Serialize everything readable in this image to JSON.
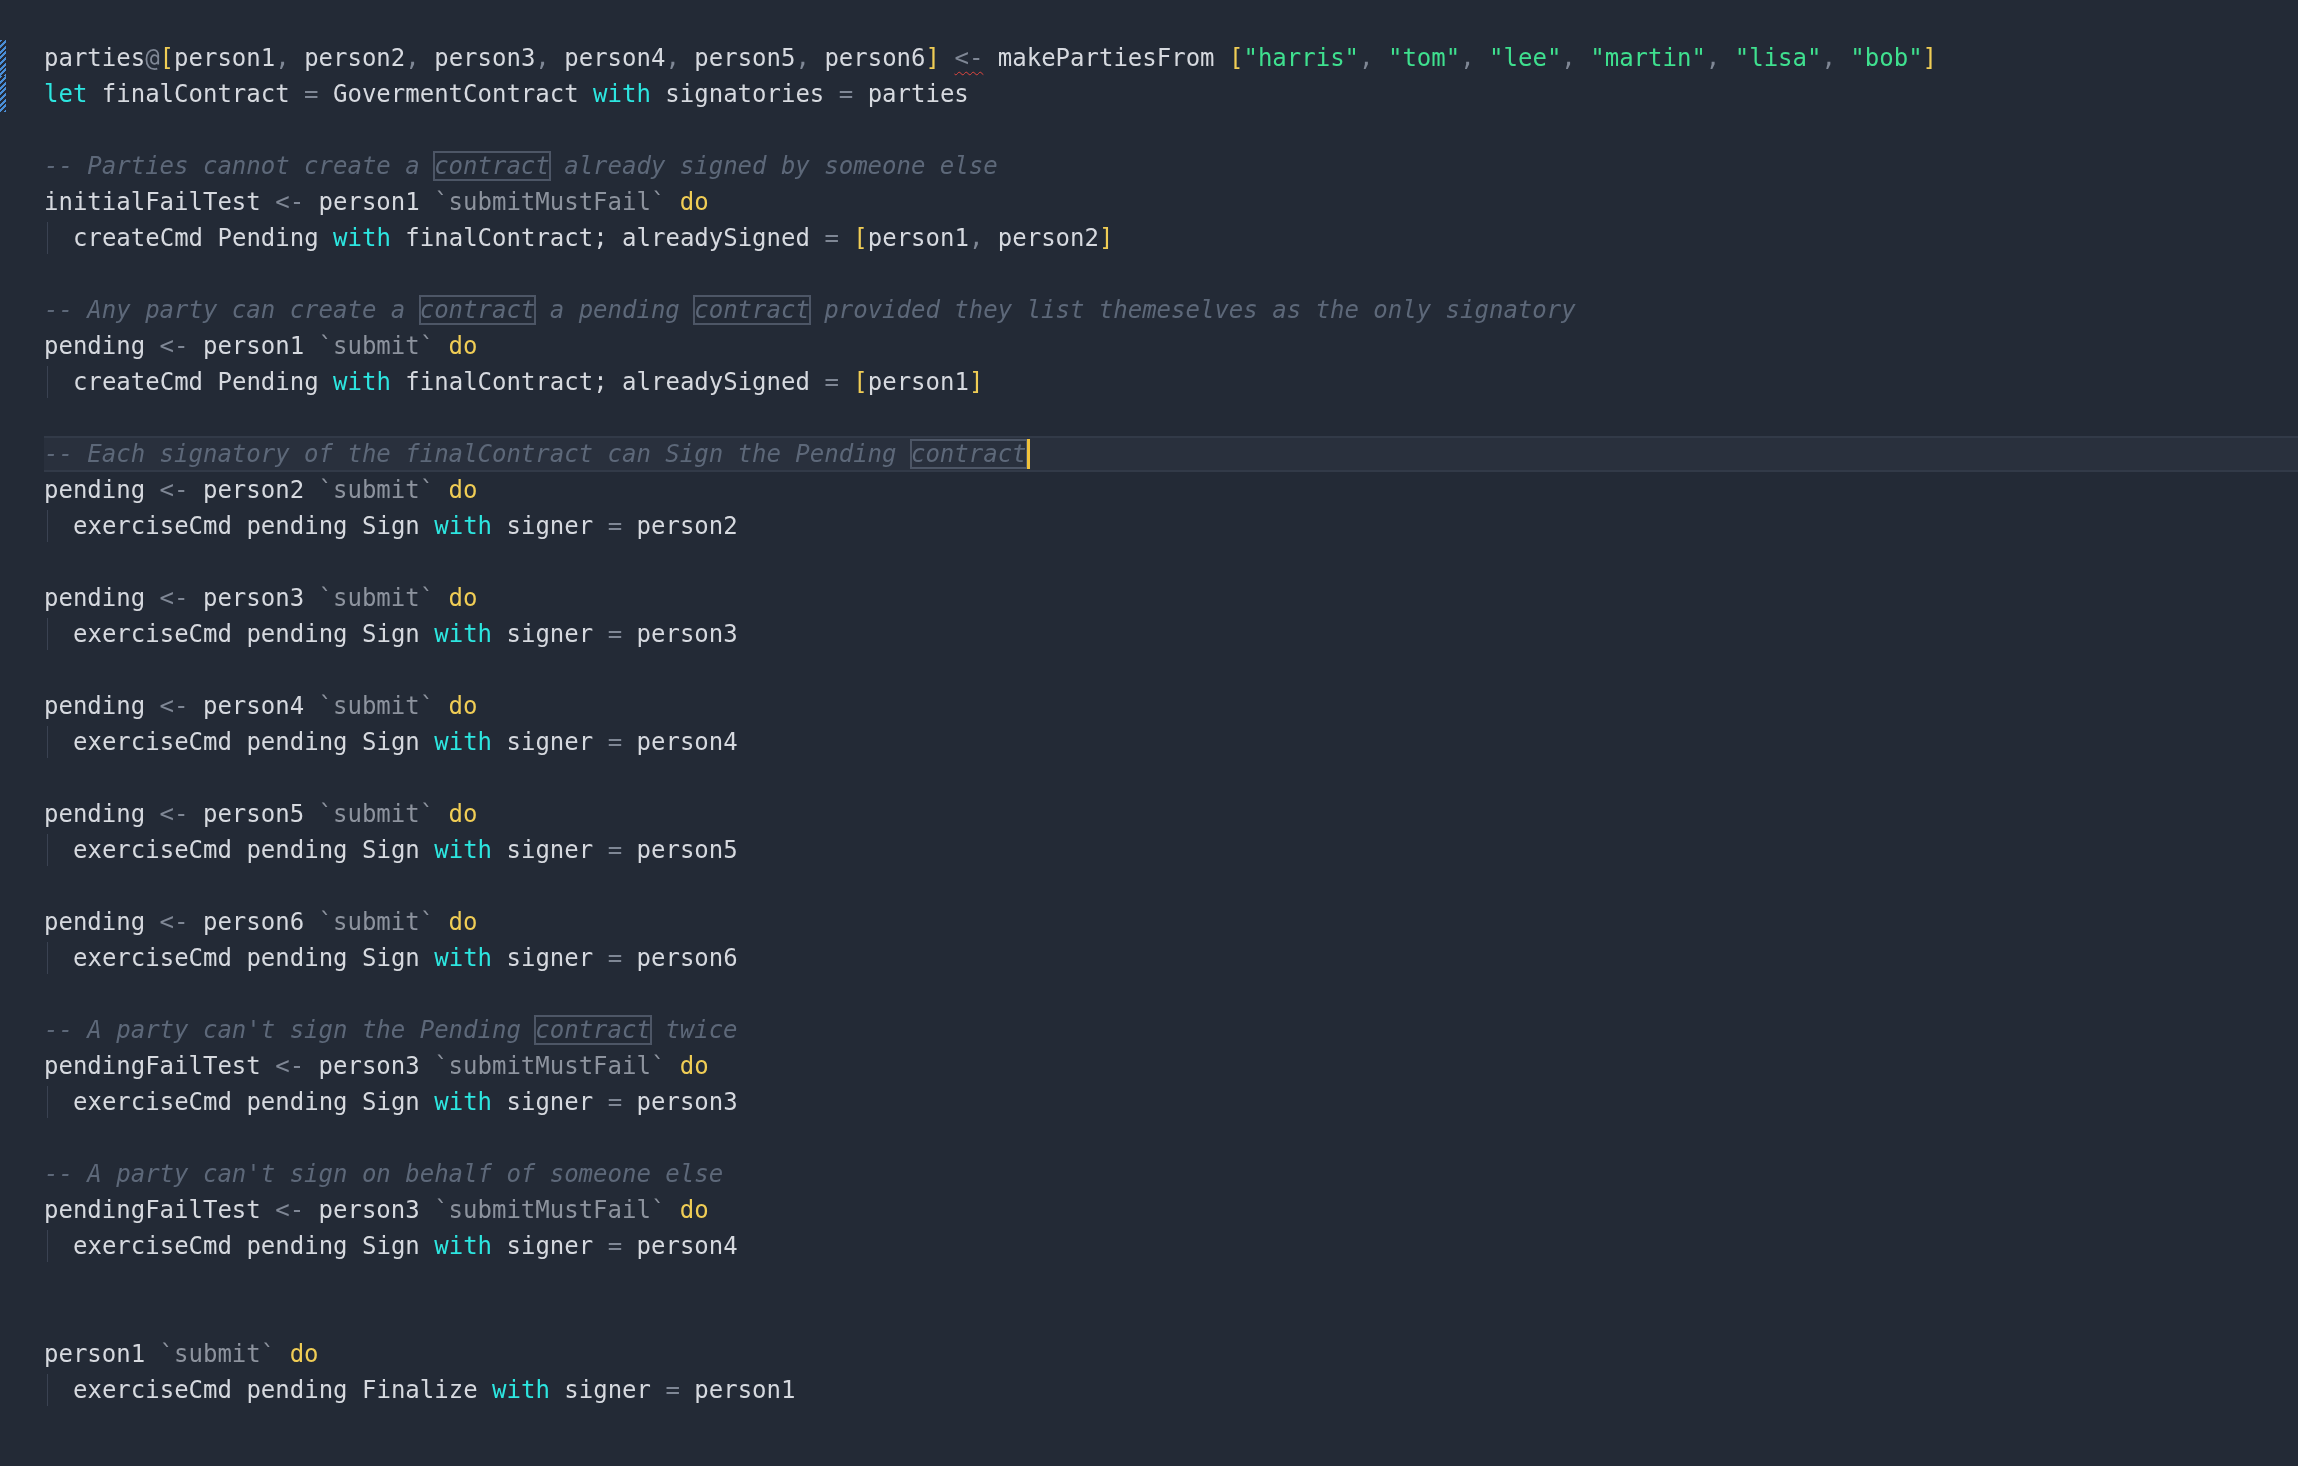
{
  "editor": {
    "lines": [
      {
        "kind": "code",
        "indented": false,
        "current": false,
        "changed": true,
        "tokens": [
          {
            "kind": "id",
            "text": "parties"
          },
          {
            "kind": "op",
            "text": "@"
          },
          {
            "kind": "bracket",
            "text": "["
          },
          {
            "kind": "id",
            "text": "person1"
          },
          {
            "kind": "op",
            "text": ", "
          },
          {
            "kind": "id",
            "text": "person2"
          },
          {
            "kind": "op",
            "text": ", "
          },
          {
            "kind": "id",
            "text": "person3"
          },
          {
            "kind": "op",
            "text": ", "
          },
          {
            "kind": "id",
            "text": "person4"
          },
          {
            "kind": "op",
            "text": ", "
          },
          {
            "kind": "id",
            "text": "person5"
          },
          {
            "kind": "op",
            "text": ", "
          },
          {
            "kind": "id",
            "text": "person6"
          },
          {
            "kind": "bracket",
            "text": "] "
          },
          {
            "kind": "error",
            "text": "<-"
          },
          {
            "kind": "id",
            "text": " makePartiesFrom "
          },
          {
            "kind": "bracket",
            "text": "["
          },
          {
            "kind": "str",
            "text": "\"harris\""
          },
          {
            "kind": "op",
            "text": ", "
          },
          {
            "kind": "str",
            "text": "\"tom\""
          },
          {
            "kind": "op",
            "text": ", "
          },
          {
            "kind": "str",
            "text": "\"lee\""
          },
          {
            "kind": "op",
            "text": ", "
          },
          {
            "kind": "str",
            "text": "\"martin\""
          },
          {
            "kind": "op",
            "text": ", "
          },
          {
            "kind": "str",
            "text": "\"lisa\""
          },
          {
            "kind": "op",
            "text": ", "
          },
          {
            "kind": "str",
            "text": "\"bob\""
          },
          {
            "kind": "bracket",
            "text": "]"
          }
        ]
      },
      {
        "kind": "code",
        "indented": false,
        "current": false,
        "changed": true,
        "tokens": [
          {
            "kind": "kw",
            "text": "let"
          },
          {
            "kind": "id",
            "text": " finalContract "
          },
          {
            "kind": "op",
            "text": "="
          },
          {
            "kind": "id",
            "text": " GovermentContract "
          },
          {
            "kind": "kw",
            "text": "with"
          },
          {
            "kind": "id",
            "text": " signatories "
          },
          {
            "kind": "op",
            "text": "="
          },
          {
            "kind": "id",
            "text": " parties"
          }
        ]
      },
      {
        "kind": "blank"
      },
      {
        "kind": "code",
        "indented": false,
        "current": false,
        "changed": false,
        "tokens": [
          {
            "kind": "comment",
            "text": "-- Parties cannot create a "
          },
          {
            "kind": "match",
            "text": "contract"
          },
          {
            "kind": "comment",
            "text": " already signed by someone else"
          }
        ]
      },
      {
        "kind": "code",
        "indented": false,
        "current": false,
        "changed": false,
        "tokens": [
          {
            "kind": "id",
            "text": "initialFailTest "
          },
          {
            "kind": "op",
            "text": "<-"
          },
          {
            "kind": "id",
            "text": " person1 "
          },
          {
            "kind": "tick",
            "text": "`submitMustFail` "
          },
          {
            "kind": "do",
            "text": "do"
          }
        ]
      },
      {
        "kind": "code",
        "indented": true,
        "current": false,
        "changed": false,
        "tokens": [
          {
            "kind": "id",
            "text": "createCmd Pending "
          },
          {
            "kind": "kw",
            "text": "with"
          },
          {
            "kind": "id",
            "text": " finalContract; alreadySigned "
          },
          {
            "kind": "op",
            "text": "= "
          },
          {
            "kind": "bracket",
            "text": "["
          },
          {
            "kind": "id",
            "text": "person1"
          },
          {
            "kind": "op",
            "text": ", "
          },
          {
            "kind": "id",
            "text": "person2"
          },
          {
            "kind": "bracket",
            "text": "]"
          }
        ]
      },
      {
        "kind": "blank"
      },
      {
        "kind": "code",
        "indented": false,
        "current": false,
        "changed": false,
        "tokens": [
          {
            "kind": "comment",
            "text": "-- Any party can create a "
          },
          {
            "kind": "match",
            "text": "contract"
          },
          {
            "kind": "comment",
            "text": " a pending "
          },
          {
            "kind": "match",
            "text": "contract"
          },
          {
            "kind": "comment",
            "text": " provided they list themeselves as the only signatory"
          }
        ]
      },
      {
        "kind": "code",
        "indented": false,
        "current": false,
        "changed": false,
        "tokens": [
          {
            "kind": "id",
            "text": "pending "
          },
          {
            "kind": "op",
            "text": "<-"
          },
          {
            "kind": "id",
            "text": " person1 "
          },
          {
            "kind": "tick",
            "text": "`submit` "
          },
          {
            "kind": "do",
            "text": "do"
          }
        ]
      },
      {
        "kind": "code",
        "indented": true,
        "current": false,
        "changed": false,
        "tokens": [
          {
            "kind": "id",
            "text": "createCmd Pending "
          },
          {
            "kind": "kw",
            "text": "with"
          },
          {
            "kind": "id",
            "text": " finalContract; alreadySigned "
          },
          {
            "kind": "op",
            "text": "= "
          },
          {
            "kind": "bracket",
            "text": "["
          },
          {
            "kind": "id",
            "text": "person1"
          },
          {
            "kind": "bracket",
            "text": "]"
          }
        ]
      },
      {
        "kind": "blank"
      },
      {
        "kind": "code",
        "indented": false,
        "current": true,
        "cursor": true,
        "changed": false,
        "tokens": [
          {
            "kind": "comment",
            "text": "-- Each signatory of the finalContract can Sign the Pending "
          },
          {
            "kind": "match",
            "text": "contract"
          }
        ]
      },
      {
        "kind": "code",
        "indented": false,
        "current": false,
        "changed": false,
        "tokens": [
          {
            "kind": "id",
            "text": "pending "
          },
          {
            "kind": "op",
            "text": "<-"
          },
          {
            "kind": "id",
            "text": " person2 "
          },
          {
            "kind": "tick",
            "text": "`submit` "
          },
          {
            "kind": "do",
            "text": "do"
          }
        ]
      },
      {
        "kind": "code",
        "indented": true,
        "current": false,
        "changed": false,
        "tokens": [
          {
            "kind": "id",
            "text": "exerciseCmd pending Sign "
          },
          {
            "kind": "kw",
            "text": "with"
          },
          {
            "kind": "id",
            "text": " signer "
          },
          {
            "kind": "op",
            "text": "="
          },
          {
            "kind": "id",
            "text": " person2"
          }
        ]
      },
      {
        "kind": "blank"
      },
      {
        "kind": "code",
        "indented": false,
        "current": false,
        "changed": false,
        "tokens": [
          {
            "kind": "id",
            "text": "pending "
          },
          {
            "kind": "op",
            "text": "<-"
          },
          {
            "kind": "id",
            "text": " person3 "
          },
          {
            "kind": "tick",
            "text": "`submit` "
          },
          {
            "kind": "do",
            "text": "do"
          }
        ]
      },
      {
        "kind": "code",
        "indented": true,
        "current": false,
        "changed": false,
        "tokens": [
          {
            "kind": "id",
            "text": "exerciseCmd pending Sign "
          },
          {
            "kind": "kw",
            "text": "with"
          },
          {
            "kind": "id",
            "text": " signer "
          },
          {
            "kind": "op",
            "text": "="
          },
          {
            "kind": "id",
            "text": " person3"
          }
        ]
      },
      {
        "kind": "blank"
      },
      {
        "kind": "code",
        "indented": false,
        "current": false,
        "changed": false,
        "tokens": [
          {
            "kind": "id",
            "text": "pending "
          },
          {
            "kind": "op",
            "text": "<-"
          },
          {
            "kind": "id",
            "text": " person4 "
          },
          {
            "kind": "tick",
            "text": "`submit` "
          },
          {
            "kind": "do",
            "text": "do"
          }
        ]
      },
      {
        "kind": "code",
        "indented": true,
        "current": false,
        "changed": false,
        "tokens": [
          {
            "kind": "id",
            "text": "exerciseCmd pending Sign "
          },
          {
            "kind": "kw",
            "text": "with"
          },
          {
            "kind": "id",
            "text": " signer "
          },
          {
            "kind": "op",
            "text": "="
          },
          {
            "kind": "id",
            "text": " person4"
          }
        ]
      },
      {
        "kind": "blank"
      },
      {
        "kind": "code",
        "indented": false,
        "current": false,
        "changed": false,
        "tokens": [
          {
            "kind": "id",
            "text": "pending "
          },
          {
            "kind": "op",
            "text": "<-"
          },
          {
            "kind": "id",
            "text": " person5 "
          },
          {
            "kind": "tick",
            "text": "`submit` "
          },
          {
            "kind": "do",
            "text": "do"
          }
        ]
      },
      {
        "kind": "code",
        "indented": true,
        "current": false,
        "changed": false,
        "tokens": [
          {
            "kind": "id",
            "text": "exerciseCmd pending Sign "
          },
          {
            "kind": "kw",
            "text": "with"
          },
          {
            "kind": "id",
            "text": " signer "
          },
          {
            "kind": "op",
            "text": "="
          },
          {
            "kind": "id",
            "text": " person5"
          }
        ]
      },
      {
        "kind": "blank"
      },
      {
        "kind": "code",
        "indented": false,
        "current": false,
        "changed": false,
        "tokens": [
          {
            "kind": "id",
            "text": "pending "
          },
          {
            "kind": "op",
            "text": "<-"
          },
          {
            "kind": "id",
            "text": " person6 "
          },
          {
            "kind": "tick",
            "text": "`submit` "
          },
          {
            "kind": "do",
            "text": "do"
          }
        ]
      },
      {
        "kind": "code",
        "indented": true,
        "current": false,
        "changed": false,
        "tokens": [
          {
            "kind": "id",
            "text": "exerciseCmd pending Sign "
          },
          {
            "kind": "kw",
            "text": "with"
          },
          {
            "kind": "id",
            "text": " signer "
          },
          {
            "kind": "op",
            "text": "="
          },
          {
            "kind": "id",
            "text": " person6"
          }
        ]
      },
      {
        "kind": "blank"
      },
      {
        "kind": "code",
        "indented": false,
        "current": false,
        "changed": false,
        "tokens": [
          {
            "kind": "comment",
            "text": "-- A party can't sign the Pending "
          },
          {
            "kind": "match",
            "text": "contract"
          },
          {
            "kind": "comment",
            "text": " twice"
          }
        ]
      },
      {
        "kind": "code",
        "indented": false,
        "current": false,
        "changed": false,
        "tokens": [
          {
            "kind": "id",
            "text": "pendingFailTest "
          },
          {
            "kind": "op",
            "text": "<-"
          },
          {
            "kind": "id",
            "text": " person3 "
          },
          {
            "kind": "tick",
            "text": "`submitMustFail` "
          },
          {
            "kind": "do",
            "text": "do"
          }
        ]
      },
      {
        "kind": "code",
        "indented": true,
        "current": false,
        "changed": false,
        "tokens": [
          {
            "kind": "id",
            "text": "exerciseCmd pending Sign "
          },
          {
            "kind": "kw",
            "text": "with"
          },
          {
            "kind": "id",
            "text": " signer "
          },
          {
            "kind": "op",
            "text": "="
          },
          {
            "kind": "id",
            "text": " person3"
          }
        ]
      },
      {
        "kind": "blank"
      },
      {
        "kind": "code",
        "indented": false,
        "current": false,
        "changed": false,
        "tokens": [
          {
            "kind": "comment",
            "text": "-- A party can't sign on behalf of someone else"
          }
        ]
      },
      {
        "kind": "code",
        "indented": false,
        "current": false,
        "changed": false,
        "tokens": [
          {
            "kind": "id",
            "text": "pendingFailTest "
          },
          {
            "kind": "op",
            "text": "<-"
          },
          {
            "kind": "id",
            "text": " person3 "
          },
          {
            "kind": "tick",
            "text": "`submitMustFail` "
          },
          {
            "kind": "do",
            "text": "do"
          }
        ]
      },
      {
        "kind": "code",
        "indented": true,
        "current": false,
        "changed": false,
        "tokens": [
          {
            "kind": "id",
            "text": "exerciseCmd pending Sign "
          },
          {
            "kind": "kw",
            "text": "with"
          },
          {
            "kind": "id",
            "text": " signer "
          },
          {
            "kind": "op",
            "text": "="
          },
          {
            "kind": "id",
            "text": " person4"
          }
        ]
      },
      {
        "kind": "blank"
      },
      {
        "kind": "blank"
      },
      {
        "kind": "code",
        "indented": false,
        "current": false,
        "changed": false,
        "tokens": [
          {
            "kind": "id",
            "text": "person1 "
          },
          {
            "kind": "tick",
            "text": "`submit` "
          },
          {
            "kind": "do",
            "text": "do"
          }
        ]
      },
      {
        "kind": "code",
        "indented": true,
        "current": false,
        "changed": false,
        "tokens": [
          {
            "kind": "id",
            "text": "exerciseCmd pending Finalize "
          },
          {
            "kind": "kw",
            "text": "with"
          },
          {
            "kind": "id",
            "text": " signer "
          },
          {
            "kind": "op",
            "text": "="
          },
          {
            "kind": "id",
            "text": " person1"
          }
        ]
      }
    ]
  }
}
